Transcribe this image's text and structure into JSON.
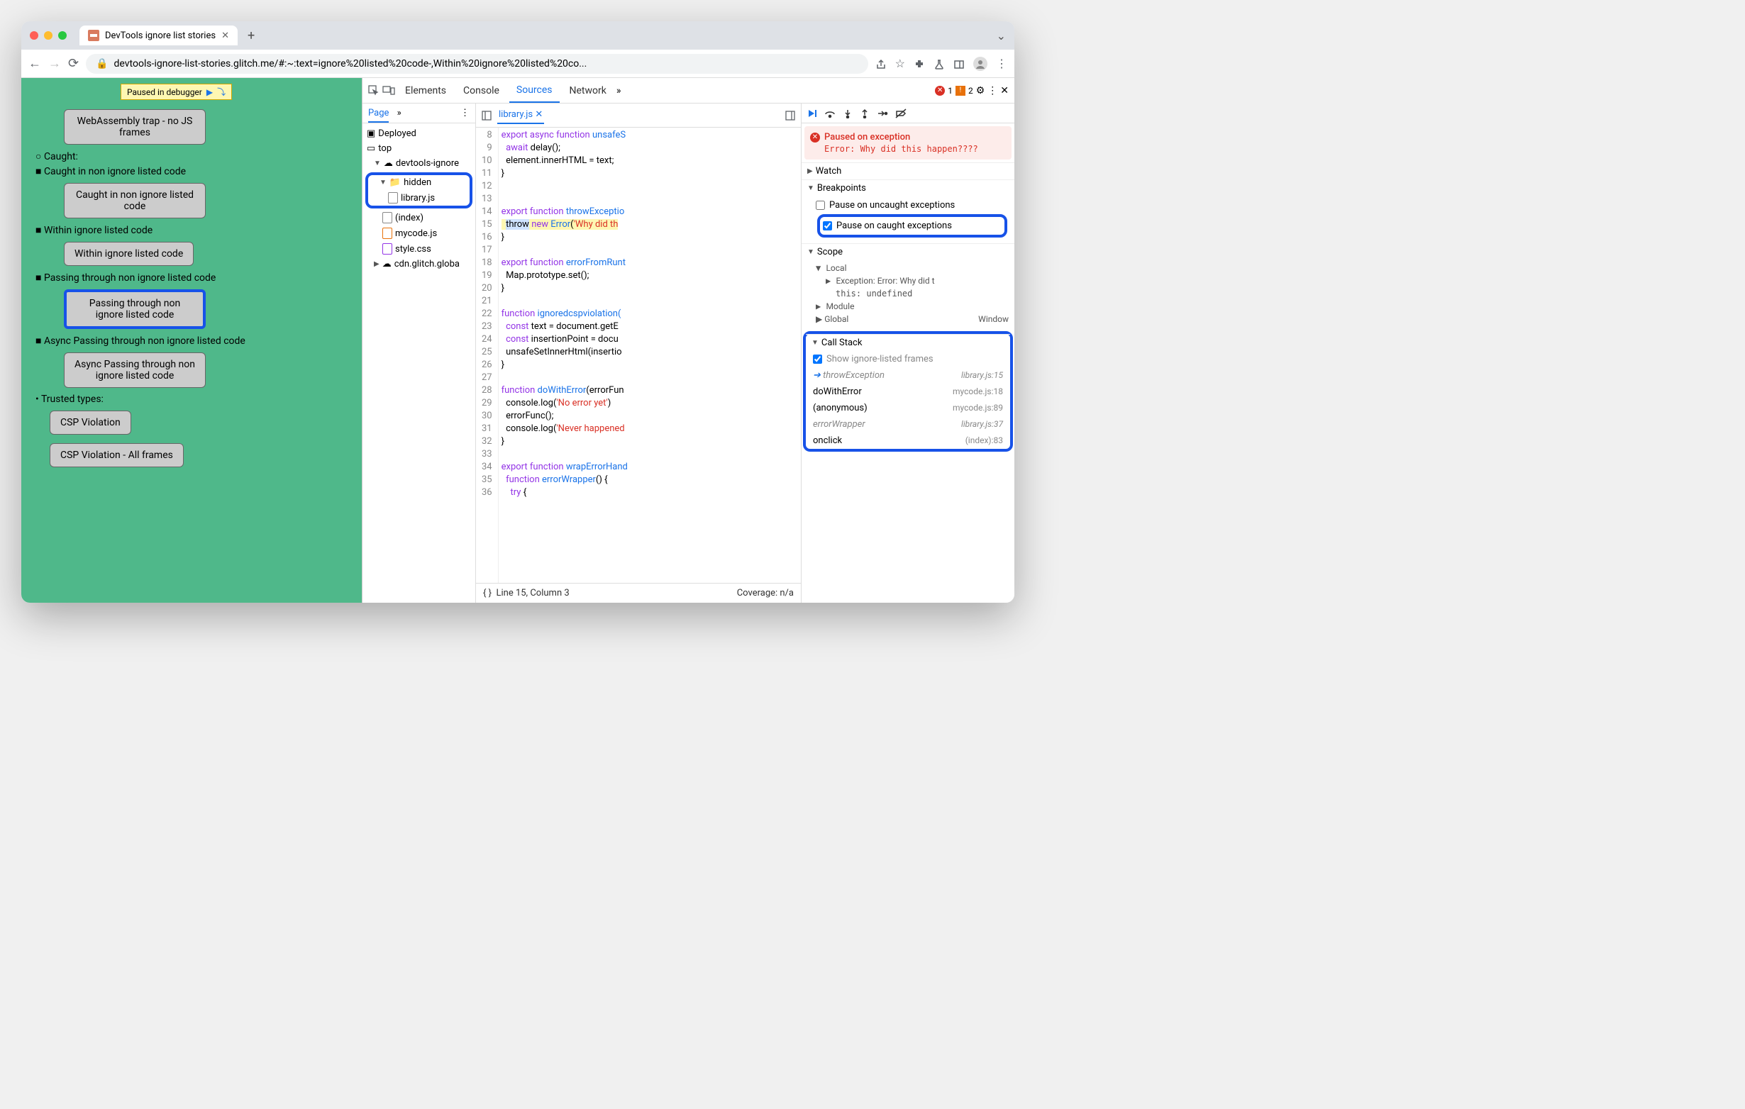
{
  "browser": {
    "tab_title": "DevTools ignore list stories",
    "url": "devtools-ignore-list-stories.glitch.me/#:~:text=ignore%20listed%20code-,Within%20ignore%20listed%20co..."
  },
  "paused_badge": "Paused in debugger",
  "page": {
    "item_webassembly": "WebAssembly trap - no JS frames",
    "caught_header": "Caught:",
    "caught_non_ignore_label": "Caught in non ignore listed code",
    "caught_non_ignore_btn": "Caught in non ignore listed code",
    "within_ignore_label": "Within ignore listed code",
    "within_ignore_btn": "Within ignore listed code",
    "passing_label": "Passing through non ignore listed code",
    "passing_btn": "Passing through non ignore listed code",
    "async_label": "Async Passing through non ignore listed code",
    "async_btn": "Async Passing through non ignore listed code",
    "trusted_header": "Trusted types:",
    "csp1": "CSP Violation",
    "csp2": "CSP Violation - All frames"
  },
  "devtools": {
    "tabs": {
      "elements": "Elements",
      "console": "Console",
      "sources": "Sources",
      "network": "Network"
    },
    "errors": "1",
    "warnings": "2",
    "page_tab": "Page",
    "tree": {
      "deployed": "Deployed",
      "top": "top",
      "origin": "devtools-ignore",
      "hidden": "hidden",
      "library": "library.js",
      "index": "(index)",
      "mycode": "mycode.js",
      "style": "style.css",
      "cdn": "cdn.glitch.globa"
    },
    "open_file": "library.js",
    "code": {
      "l8": "export async function unsafeS",
      "l9": "  await delay();",
      "l10": "  element.innerHTML = text;",
      "l11": "}",
      "l12": "",
      "l13": "",
      "l14": "export function throwExceptio",
      "l15a": "  throw",
      "l15b": " new Error('Why did th",
      "l16": "}",
      "l17": "",
      "l18": "export function errorFromRunt",
      "l19": "  Map.prototype.set();",
      "l20": "}",
      "l21": "",
      "l22": "function ignoredcspviolation(",
      "l23": "  const text = document.getE",
      "l24": "  const insertionPoint = docu",
      "l25": "  unsafeSetInnerHtml(insertio",
      "l26": "}",
      "l27": "",
      "l28": "function doWithError(errorFun",
      "l29": "  console.log('No error yet')",
      "l30": "  errorFunc();",
      "l31": "  console.log('Never happened",
      "l32": "}",
      "l33": "",
      "l34": "export function wrapErrorHand",
      "l35": "  function errorWrapper() {",
      "l36": "    try {"
    },
    "status_line": "Line 15, Column 3",
    "status_coverage": "Coverage: n/a",
    "paused_hdr": "Paused on exception",
    "paused_msg": "Error: Why did this happen????",
    "watch": "Watch",
    "breakpoints": "Breakpoints",
    "bp_uncaught": "Pause on uncaught exceptions",
    "bp_caught": "Pause on caught exceptions",
    "scope": "Scope",
    "scope_local": "Local",
    "scope_exc": "Exception: Error: Why did t",
    "scope_this": "this: undefined",
    "scope_module": "Module",
    "scope_global": "Global",
    "scope_window": "Window",
    "callstack": "Call Stack",
    "cs_show": "Show ignore-listed frames",
    "cs": [
      {
        "fn": "throwException",
        "loc": "library.js:15",
        "ignored": true,
        "current": true
      },
      {
        "fn": "doWithError",
        "loc": "mycode.js:18",
        "ignored": false
      },
      {
        "fn": "(anonymous)",
        "loc": "mycode.js:89",
        "ignored": false
      },
      {
        "fn": "errorWrapper",
        "loc": "library.js:37",
        "ignored": true
      },
      {
        "fn": "onclick",
        "loc": "(index):83",
        "ignored": false
      }
    ]
  }
}
